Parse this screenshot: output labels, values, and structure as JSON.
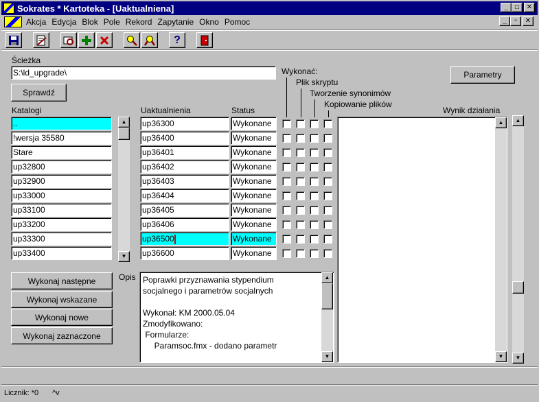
{
  "window": {
    "title": "Sokrates * Kartoteka - [Uaktualniena]",
    "controls": {
      "minimize": "_",
      "maximize": "□",
      "close": "✕",
      "restore": "▫"
    }
  },
  "menu": [
    {
      "label": "Akcja"
    },
    {
      "label": "Edycja"
    },
    {
      "label": "Blok"
    },
    {
      "label": "Pole"
    },
    {
      "label": "Rekord"
    },
    {
      "label": "Zapytanie"
    },
    {
      "label": "Okno"
    },
    {
      "label": "Pomoc"
    }
  ],
  "toolbar": {
    "icons": [
      "save-icon",
      "edit-document-icon",
      "print-preview-icon",
      "add-icon",
      "delete-icon",
      "search-icon",
      "search-advanced-icon",
      "help-icon",
      "exit-door-icon"
    ],
    "help_glyph": "?"
  },
  "path": {
    "label": "Ścieżka",
    "value": "S:\\ld_upgrade\\"
  },
  "check_button": "Sprawdź",
  "params_button": "Parametry",
  "execute_label": "Wykonać:",
  "col_headers": {
    "katalogi": "Katalogi",
    "uaktualnienia": "Uaktualnienia",
    "status": "Status",
    "plik_skryptu": "Plik skryptu",
    "tworzenie_synonimow": "Tworzenie synonimów",
    "kopiowanie_plikow": "Kopiowanie plików",
    "wynik": "Wynik działania"
  },
  "katalogi": [
    "..",
    "!wersja 35580",
    "Stare",
    "up32800",
    "up32900",
    "up33000",
    "up33100",
    "up33200",
    "up33300",
    "up33400"
  ],
  "updates": [
    {
      "name": "up36300",
      "status": "Wykonane"
    },
    {
      "name": "up36400",
      "status": "Wykonane"
    },
    {
      "name": "up36401",
      "status": "Wykonane"
    },
    {
      "name": "up36402",
      "status": "Wykonane"
    },
    {
      "name": "up36403",
      "status": "Wykonane"
    },
    {
      "name": "up36404",
      "status": "Wykonane"
    },
    {
      "name": "up36405",
      "status": "Wykonane"
    },
    {
      "name": "up36406",
      "status": "Wykonane"
    },
    {
      "name": "up36500",
      "status": "Wykonane"
    },
    {
      "name": "up36600",
      "status": "Wykonane"
    }
  ],
  "selected_update": "up36500",
  "actions": [
    "Wykonaj następne",
    "Wykonaj wskazane",
    "Wykonaj nowe",
    "Wykonaj zaznaczone"
  ],
  "opis": {
    "label": "Opis",
    "text": "Poprawki przyznawania stypendium\nsocjalnego i parametrów socjalnych\n\nWykonał: KM 2000.05.04\nZmodyfikowano:\n Formularze:\n     Paramsoc.fmx - dodano parametr"
  },
  "status_bar": {
    "counter": "Licznik: *0",
    "mode": "^v"
  },
  "colors": {
    "title_bg": "#000080",
    "selection": "#00ffff",
    "face": "#c0c0c0"
  }
}
